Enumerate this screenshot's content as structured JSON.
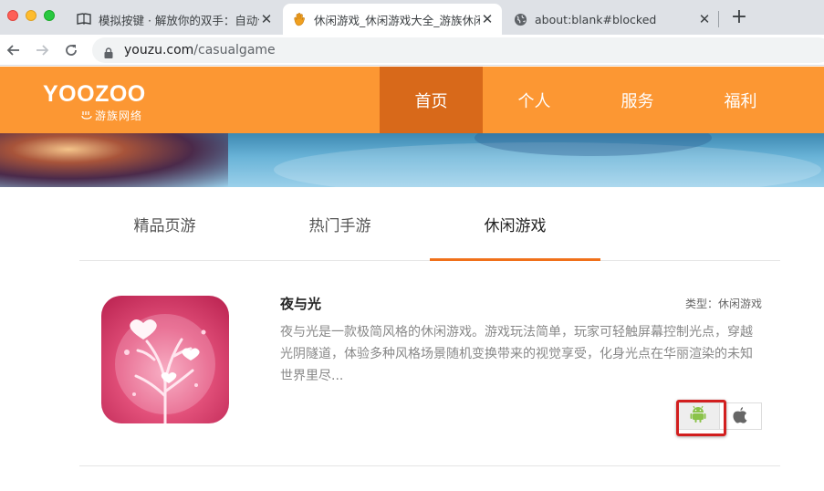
{
  "browser": {
    "tabs": [
      {
        "title": "模拟按键 · 解放你的双手：自动化",
        "favicon": "book-icon",
        "active": false
      },
      {
        "title": "休闲游戏_休闲游戏大全_游族休闲",
        "favicon": "hand-icon",
        "active": true
      },
      {
        "title": "about:blank#blocked",
        "favicon": "globe-icon",
        "active": false
      }
    ],
    "address": {
      "domain": "youzu.com",
      "path": "/casualgame"
    }
  },
  "header": {
    "logo_main": "YOOZOO",
    "logo_sub": "游族网络",
    "menu": [
      {
        "label": "首页",
        "active": true
      },
      {
        "label": "个人",
        "active": false
      },
      {
        "label": "服务",
        "active": false
      },
      {
        "label": "福利",
        "active": false
      }
    ],
    "brand_color": "#fc9733",
    "active_color": "#d8691a"
  },
  "categories": [
    {
      "label": "精品页游",
      "active": false
    },
    {
      "label": "热门手游",
      "active": false
    },
    {
      "label": "休闲游戏",
      "active": true
    }
  ],
  "game": {
    "title": "夜与光",
    "type_label": "类型：休闲游戏",
    "description": "夜与光是一款极简风格的休闲游戏。游戏玩法简单，玩家可轻触屏幕控制光点，穿越光阴隧道，体验多种风格场景随机变换带来的视觉享受，化身光点在华丽渲染的未知世界里尽...",
    "downloads": [
      {
        "platform": "android",
        "icon": "android-icon",
        "highlighted": true
      },
      {
        "platform": "ios",
        "icon": "apple-icon",
        "highlighted": false
      }
    ]
  }
}
